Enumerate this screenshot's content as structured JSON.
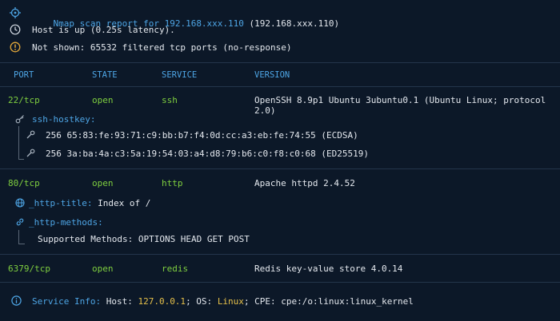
{
  "summary": {
    "report_prefix": "Nmap scan report for ",
    "report_host": "192.168.xxx.110",
    "report_suffix": " (192.168.xxx.110)",
    "host_up": "Host is up (0.25s latency).",
    "not_shown": "Not shown: 65532 filtered tcp ports (no-response)"
  },
  "columns": {
    "port": "PORT",
    "state": "STATE",
    "service": "SERVICE",
    "version": "VERSION"
  },
  "ports": [
    {
      "port": "22/tcp",
      "state": "open",
      "service": "ssh",
      "version": "OpenSSH 8.9p1 Ubuntu 3ubuntu0.1 (Ubuntu Linux; protocol 2.0)",
      "script": {
        "name": "ssh-hostkey:",
        "lines": [
          "256 65:83:fe:93:71:c9:bb:b7:f4:0d:cc:a3:eb:fe:74:55 (ECDSA)",
          "256 3a:ba:4a:c3:5a:19:54:03:a4:d8:79:b6:c0:f8:c0:68 (ED25519)"
        ]
      }
    },
    {
      "port": "80/tcp",
      "state": "open",
      "service": "http",
      "version": "Apache httpd 2.4.52",
      "script_title": {
        "name": "_http-title:",
        "value": " Index of /"
      },
      "script_methods": {
        "name": "_http-methods:",
        "value": "Supported Methods: OPTIONS HEAD GET POST"
      }
    },
    {
      "port": "6379/tcp",
      "state": "open",
      "service": "redis",
      "version": "Redis key-value store 4.0.14"
    }
  ],
  "service_info": {
    "label": "Service Info:",
    "host_label": " Host: ",
    "host_value": "127.0.0.1",
    "os_label": "; OS: ",
    "os_value": "Linux",
    "cpe": "; CPE: cpe:/o:linux:linux_kernel"
  },
  "icons": {
    "report": "crosshair-icon",
    "host_up": "clock-icon",
    "not_shown": "warning-icon",
    "ssh_hostkey": "key-icon",
    "key_line": "wrench-icon",
    "http_title": "globe-icon",
    "http_methods": "link-icon",
    "service_info": "info-icon"
  },
  "colors": {
    "background": "#0c1828",
    "accent_blue": "#4ea6e6",
    "open_green": "#7fcf3f",
    "highlight_yellow": "#e6c04a",
    "warning_orange": "#e0a63a"
  }
}
